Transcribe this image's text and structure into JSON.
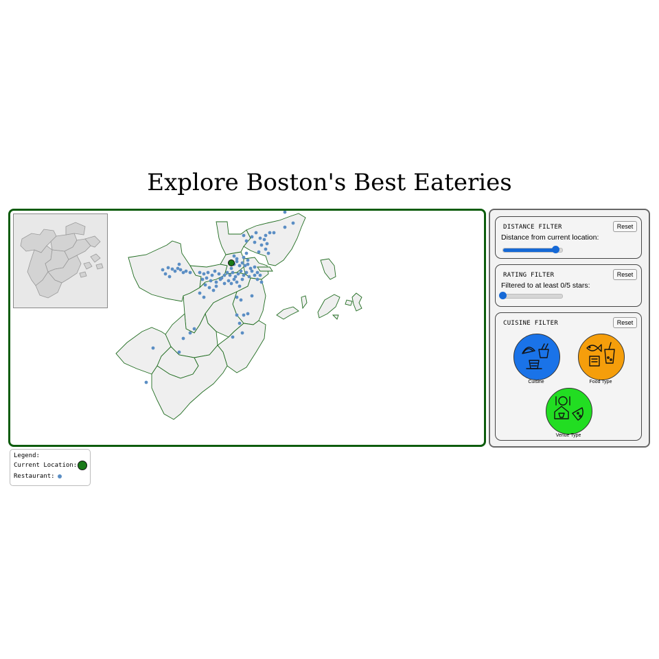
{
  "page": {
    "title": "Explore Boston's Best Eateries"
  },
  "map": {
    "frame_color": "#0d5c0d",
    "region_fill": "#efefef",
    "region_stroke": "#1e6b1e",
    "restaurant_color": "#5b8ec4",
    "current_location_color": "#1a7a1a"
  },
  "filters": {
    "distance": {
      "heading": "DISTANCE FILTER",
      "label": "Distance from current location:",
      "reset_label": "Reset",
      "slider_fraction": 0.9
    },
    "rating": {
      "heading": "RATING FILTER",
      "label": "Filtered to at least 0/5 stars:",
      "reset_label": "Reset",
      "slider_fraction": 0.0
    },
    "cuisine": {
      "heading": "CUISINE FILTER",
      "reset_label": "Reset",
      "options": [
        {
          "label": "Cuisine",
          "color": "#1a73e8",
          "icon": "taco-noodles-icon"
        },
        {
          "label": "Food Type",
          "color": "#f59e0b",
          "icon": "fish-drink-icon"
        },
        {
          "label": "Venue Type",
          "color": "#22dd22",
          "icon": "plate-shop-pizza-icon"
        }
      ]
    }
  },
  "legend": {
    "title": "Legend:",
    "current_location_label": "Current Location:",
    "restaurant_label": "Restaurant:"
  }
}
